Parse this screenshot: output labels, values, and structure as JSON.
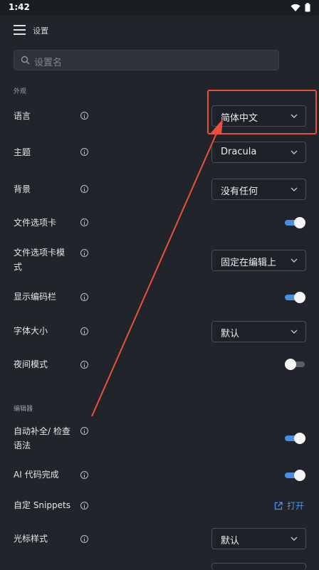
{
  "status_bar": {
    "time": "1:42",
    "icons": [
      "wifi-icon",
      "battery-icon"
    ]
  },
  "app_bar": {
    "menu_icon": "hamburger-menu-icon",
    "title": "设置"
  },
  "search": {
    "placeholder": "设置名",
    "icon": "search-icon"
  },
  "sections": {
    "appearance": "外观",
    "editor": "编辑器"
  },
  "settings": {
    "language": {
      "label": "语言",
      "value": "简体中文"
    },
    "theme": {
      "label": "主题",
      "value": "Dracula"
    },
    "background": {
      "label": "背景",
      "value": "没有任何"
    },
    "file_tabs": {
      "label": "文件选项卡",
      "enabled": true
    },
    "file_tab_mode": {
      "label_line1": "文件选项卡模",
      "label_line2": "式",
      "value": "固定在编辑上"
    },
    "show_code_bar": {
      "label": "显示编码栏",
      "enabled": true
    },
    "font_size": {
      "label": "字体大小",
      "value": "默认"
    },
    "night_mode": {
      "label": "夜间模式",
      "enabled": false
    },
    "autocomplete": {
      "label_line1": "自动补全/ 检查",
      "label_line2": "语法",
      "enabled": true
    },
    "ai_completion": {
      "label": "AI 代码完成",
      "enabled": true
    },
    "custom_snippets": {
      "label": "自定 Snippets",
      "action": "打开"
    },
    "cursor_style": {
      "label": "光标样式",
      "value": "默认"
    }
  },
  "colors": {
    "background": "#21252b",
    "toggle_on": "#4a8fe0",
    "link": "#4a93e8",
    "annotation": "#e8523d"
  }
}
